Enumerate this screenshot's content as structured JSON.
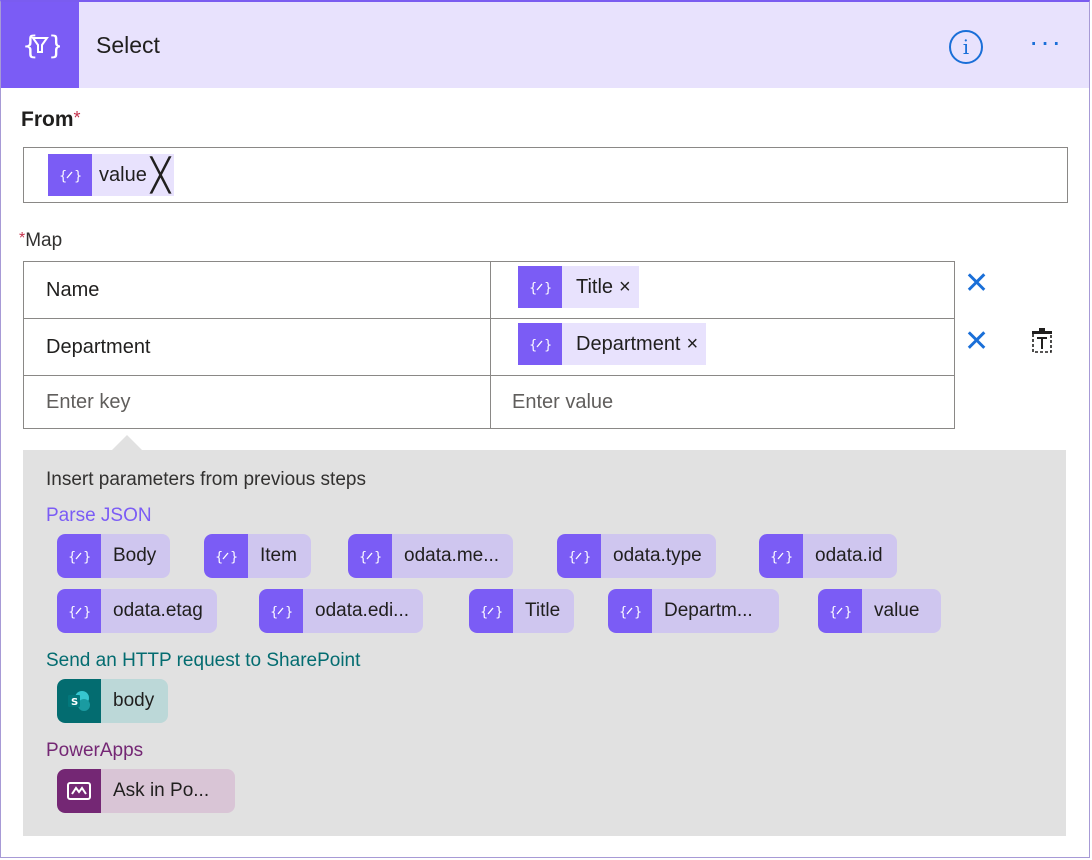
{
  "action": {
    "title": "Select",
    "icon": "data-operation-icon",
    "info_glyph": "i",
    "more_glyph": "···",
    "accent": "#7b5cf5"
  },
  "from": {
    "label": "From",
    "required_mark": "*",
    "token": {
      "label": "value",
      "close": "╳"
    }
  },
  "map": {
    "label": "Map",
    "required_mark": "*",
    "rows": [
      {
        "key": "Name",
        "value_token": "Title",
        "close": "×"
      },
      {
        "key": "Department",
        "value_token": "Department",
        "close": "×"
      }
    ],
    "empty_row": {
      "key_placeholder": "Enter key",
      "value_placeholder": "Enter value"
    },
    "delete_glyph": "✕"
  },
  "dynamic_content": {
    "header": "Insert parameters from previous steps",
    "sections": [
      {
        "title": "Parse JSON",
        "title_color": "#7b5cf5",
        "items": [
          "Body",
          "Item",
          "odata.me...",
          "odata.type",
          "odata.id",
          "odata.etag",
          "odata.edi...",
          "Title",
          "Departm...",
          "value"
        ]
      },
      {
        "title": "Send an HTTP request to SharePoint",
        "title_color": "#036c70",
        "items": [
          "body"
        ]
      },
      {
        "title": "PowerApps",
        "title_color": "#742774",
        "items": [
          "Ask in Po..."
        ]
      }
    ]
  }
}
